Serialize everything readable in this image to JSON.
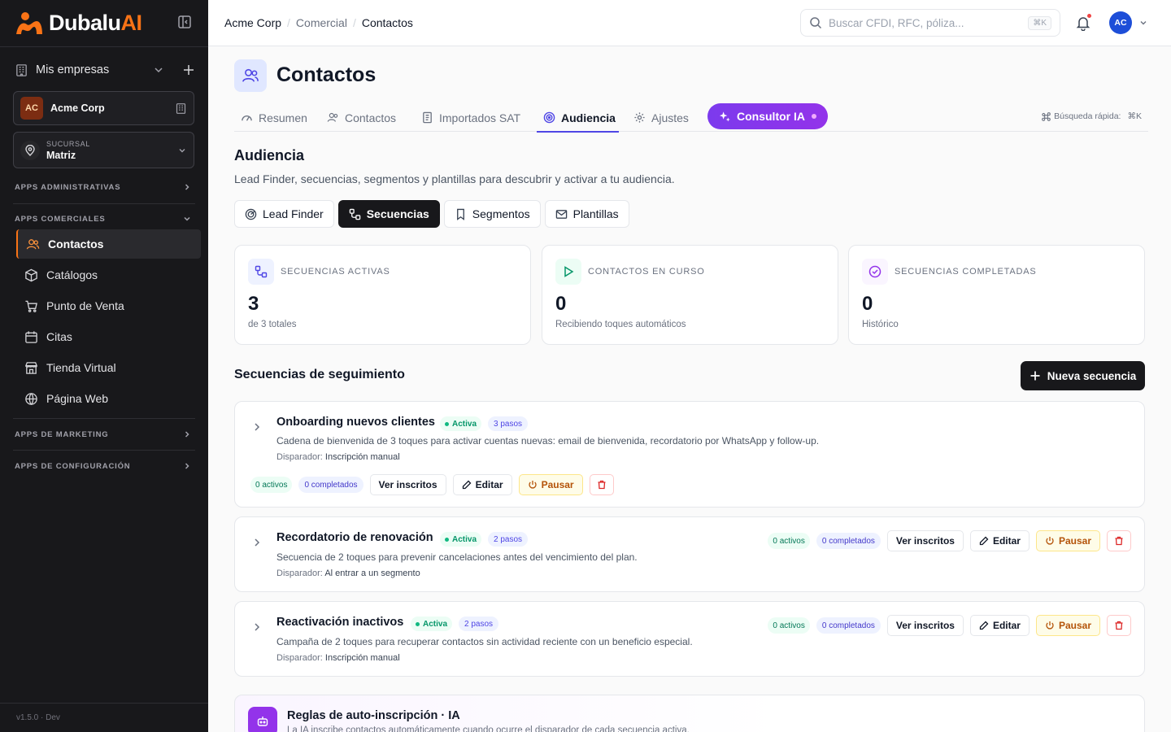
{
  "brand": {
    "name_main": "Dubalu",
    "name_accent": "AI",
    "version": "v1.5.0 · Dev",
    "accent_color": "#f97316"
  },
  "sidebar": {
    "mis_empresas": "Mis empresas",
    "company": {
      "initials": "AC",
      "name": "Acme Corp"
    },
    "branch": {
      "label": "SUCURSAL",
      "value": "Matriz"
    },
    "sections": {
      "admin": "APPS ADMINISTRATIVAS",
      "comercial": "APPS COMERCIALES",
      "marketing": "APPS DE MARKETING",
      "config": "APPS DE CONFIGURACIÓN"
    },
    "items": [
      {
        "label": "Contactos",
        "icon": "users-icon"
      },
      {
        "label": "Catálogos",
        "icon": "box-icon"
      },
      {
        "label": "Punto de Venta",
        "icon": "cart-icon"
      },
      {
        "label": "Citas",
        "icon": "calendar-icon"
      },
      {
        "label": "Tienda Virtual",
        "icon": "store-icon"
      },
      {
        "label": "Página Web",
        "icon": "globe-icon"
      }
    ]
  },
  "topbar": {
    "breadcrumb": [
      "Acme Corp",
      "Comercial",
      "Contactos"
    ],
    "search_placeholder": "Buscar CFDI, RFC, póliza...",
    "search_kbd": "⌘K",
    "avatar": "AC"
  },
  "page": {
    "title": "Contactos",
    "tabs": [
      "Resumen",
      "Contactos",
      "Importados SAT",
      "Audiencia",
      "Ajustes"
    ],
    "active_tab": "Audiencia",
    "ai_button": "Consultor IA",
    "quick_search_label": "Búsqueda rápida:",
    "quick_search_kbd": "⌘K"
  },
  "audiencia": {
    "title": "Audiencia",
    "subtitle": "Lead Finder, secuencias, segmentos y plantillas para descubrir y activar a tu audiencia.",
    "subtabs": [
      "Lead Finder",
      "Secuencias",
      "Segmentos",
      "Plantillas"
    ],
    "active_subtab": "Secuencias"
  },
  "stats": [
    {
      "label": "SECUENCIAS ACTIVAS",
      "value": "3",
      "desc": "de 3 totales",
      "color": "#4f46e5"
    },
    {
      "label": "CONTACTOS EN CURSO",
      "value": "0",
      "desc": "Recibiendo toques automáticos",
      "color": "#059669"
    },
    {
      "label": "SECUENCIAS COMPLETADAS",
      "value": "0",
      "desc": "Histórico",
      "color": "#9333ea"
    }
  ],
  "sequences": {
    "title": "Secuencias de seguimiento",
    "new_button": "Nueva secuencia",
    "trigger_label": "Disparador:",
    "labels": {
      "view": "Ver inscritos",
      "edit": "Editar",
      "pause": "Pausar"
    },
    "items": [
      {
        "name": "Onboarding nuevos clientes",
        "status": "Activa",
        "steps": "3 pasos",
        "desc": "Cadena de bienvenida de 3 toques para activar cuentas nuevas: email de bienvenida, recordatorio por WhatsApp y follow-up.",
        "trigger": "Inscripción manual",
        "activos": "0 activos",
        "completados": "0 completados"
      },
      {
        "name": "Recordatorio de renovación",
        "status": "Activa",
        "steps": "2 pasos",
        "desc": "Secuencia de 2 toques para prevenir cancelaciones antes del vencimiento del plan.",
        "trigger": "Al entrar a un segmento",
        "activos": "0 activos",
        "completados": "0 completados"
      },
      {
        "name": "Reactivación inactivos",
        "status": "Activa",
        "steps": "2 pasos",
        "desc": "Campaña de 2 toques para recuperar contactos sin actividad reciente con un beneficio especial.",
        "trigger": "Inscripción manual",
        "activos": "0 activos",
        "completados": "0 completados"
      }
    ]
  },
  "rules": {
    "title": "Reglas de auto-inscripción · IA",
    "subtitle": "La IA inscribe contactos automáticamente cuando ocurre el disparador de cada secuencia activa."
  }
}
